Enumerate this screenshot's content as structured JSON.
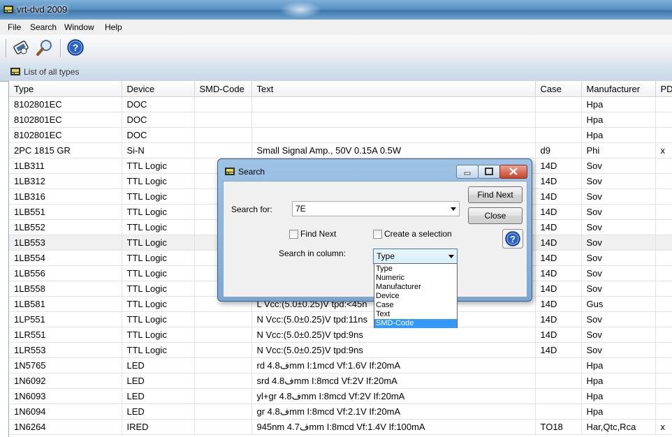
{
  "window": {
    "title": "vrt-dvd 2009"
  },
  "menu": [
    "File",
    "Search",
    "Window",
    "Help"
  ],
  "toolbar": {
    "icons": [
      "database-icon",
      "magnifier-icon",
      "help-icon"
    ]
  },
  "list_header": {
    "title": "List of all types"
  },
  "table": {
    "columns": [
      "Type",
      "Device",
      "SMD-Code",
      "Text",
      "Case",
      "Manufacturer",
      "PD"
    ],
    "rows": [
      [
        "8102801EC",
        "DOC",
        "",
        "",
        "",
        "Hpa",
        ""
      ],
      [
        "8102801EC",
        "DOC",
        "",
        "",
        "",
        "Hpa",
        ""
      ],
      [
        "8102801EC",
        "DOC",
        "",
        "",
        "",
        "Hpa",
        ""
      ],
      [
        "2PC 1815 GR",
        "Si-N",
        "",
        "Small Signal Amp., 50V 0.15A 0.5W",
        "d9",
        "Phi",
        "x"
      ],
      [
        "1LB311",
        "TTL Logic",
        "",
        "",
        "14D",
        "Sov",
        ""
      ],
      [
        "1LB312",
        "TTL Logic",
        "",
        "",
        "14D",
        "Sov",
        ""
      ],
      [
        "1LB316",
        "TTL Logic",
        "",
        "",
        "14D",
        "Sov",
        ""
      ],
      [
        "1LB551",
        "TTL Logic",
        "",
        "",
        "14D",
        "Sov",
        ""
      ],
      [
        "1LB552",
        "TTL Logic",
        "",
        "",
        "14D",
        "Sov",
        ""
      ],
      [
        "1LB553",
        "TTL Logic",
        "",
        "",
        "14D",
        "Sov",
        ""
      ],
      [
        "1LB554",
        "TTL Logic",
        "",
        "",
        "14D",
        "Sov",
        ""
      ],
      [
        "1LB556",
        "TTL Logic",
        "",
        "",
        "14D",
        "Sov",
        ""
      ],
      [
        "1LB558",
        "TTL Logic",
        "",
        "",
        "14D",
        "Sov",
        ""
      ],
      [
        "1LB581",
        "TTL Logic",
        "",
        "L Vcc:(5.0±0.25)V tpd:<45n",
        "14D",
        "Gus",
        ""
      ],
      [
        "1LP551",
        "TTL Logic",
        "",
        "N Vcc:(5.0±0.25)V tpd:11ns",
        "14D",
        "Sov",
        ""
      ],
      [
        "1LR551",
        "TTL Logic",
        "",
        "N Vcc:(5.0±0.25)V tpd:9ns",
        "14D",
        "Sov",
        ""
      ],
      [
        "1LR553",
        "TTL Logic",
        "",
        "N Vcc:(5.0±0.25)V tpd:9ns",
        "14D",
        "Sov",
        ""
      ],
      [
        "1N5765",
        "LED",
        "",
        "rd 4.8فmm I:1mcd Vf:1.6V If:20mA",
        "",
        "Hpa",
        ""
      ],
      [
        "1N6092",
        "LED",
        "",
        "srd 4.8فmm I:8mcd Vf:2V If:20mA",
        "",
        "Hpa",
        ""
      ],
      [
        "1N6093",
        "LED",
        "",
        "yl+gr 4.8فmm I:8mcd Vf:2V If:20mA",
        "",
        "Hpa",
        ""
      ],
      [
        "1N6094",
        "LED",
        "",
        "gr 4.8فmm I:8mcd Vf:2.1V If:20mA",
        "",
        "Hpa",
        ""
      ],
      [
        "1N6264",
        "IRED",
        "",
        "945nm 4.7فmm I:8mcd Vf:1.4V If:100mA",
        "TO18",
        "Har,Qtc,Rca",
        "x"
      ]
    ],
    "selected_row_index": 9
  },
  "search_dialog": {
    "title": "Search",
    "search_for_label": "Search for:",
    "search_value": "7E",
    "find_next_button": "Find Next",
    "close_button": "Close",
    "find_next_checkbox": "Find Next",
    "create_selection_checkbox": "Create a selection",
    "search_in_column_label": "Search in column:",
    "column_selected": "Type",
    "column_options": [
      "Type",
      "Numeric",
      "Manufacturer",
      "Device",
      "Case",
      "Text",
      "SMD-Code"
    ],
    "highlighted_option": "SMD-Code"
  }
}
